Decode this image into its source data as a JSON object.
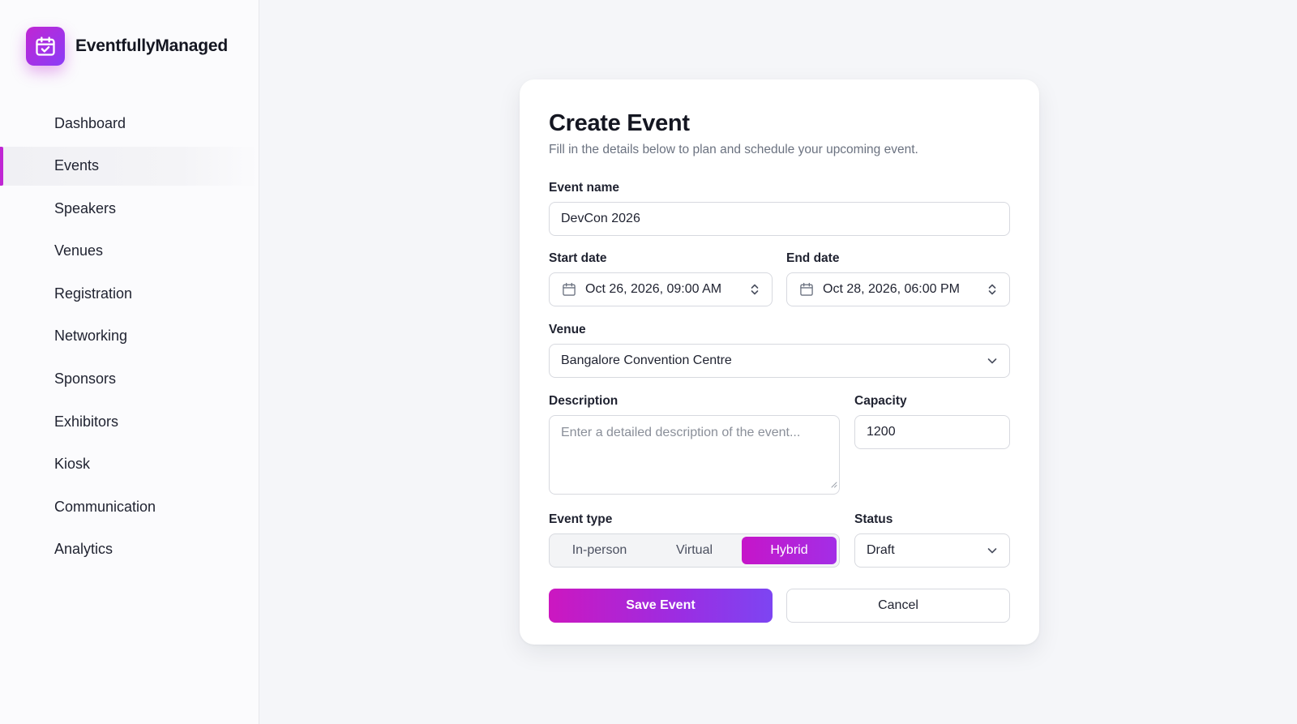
{
  "brand": {
    "name": "EventfullyManaged",
    "icon": "calendar-check-icon"
  },
  "sidebar": {
    "items": [
      {
        "label": "Dashboard",
        "active": false
      },
      {
        "label": "Events",
        "active": true
      },
      {
        "label": "Speakers",
        "active": false
      },
      {
        "label": "Venues",
        "active": false
      },
      {
        "label": "Registration",
        "active": false
      },
      {
        "label": "Networking",
        "active": false
      },
      {
        "label": "Sponsors",
        "active": false
      },
      {
        "label": "Exhibitors",
        "active": false
      },
      {
        "label": "Kiosk",
        "active": false
      },
      {
        "label": "Communication",
        "active": false
      },
      {
        "label": "Analytics",
        "active": false
      }
    ]
  },
  "form": {
    "title": "Create Event",
    "subtitle": "Fill in the details below to plan and schedule your upcoming event.",
    "event_name": {
      "label": "Event name",
      "value": "DevCon 2026"
    },
    "start_date": {
      "label": "Start date",
      "value": "Oct 26, 2026, 09:00 AM"
    },
    "end_date": {
      "label": "End date",
      "value": "Oct 28, 2026, 06:00 PM"
    },
    "venue": {
      "label": "Venue",
      "value": "Bangalore Convention Centre"
    },
    "description": {
      "label": "Description",
      "placeholder": "Enter a detailed description of the event..."
    },
    "capacity": {
      "label": "Capacity",
      "value": "1200"
    },
    "event_type": {
      "label": "Event type",
      "options": [
        "In-person",
        "Virtual",
        "Hybrid"
      ],
      "selected": "Hybrid"
    },
    "status": {
      "label": "Status",
      "value": "Draft"
    },
    "save_label": "Save Event",
    "cancel_label": "Cancel"
  },
  "colors": {
    "accent": "#c026d3",
    "accent_end": "#7d45f2",
    "background": "#f5f6f9",
    "sidebar_bg": "#fbfbfd"
  }
}
